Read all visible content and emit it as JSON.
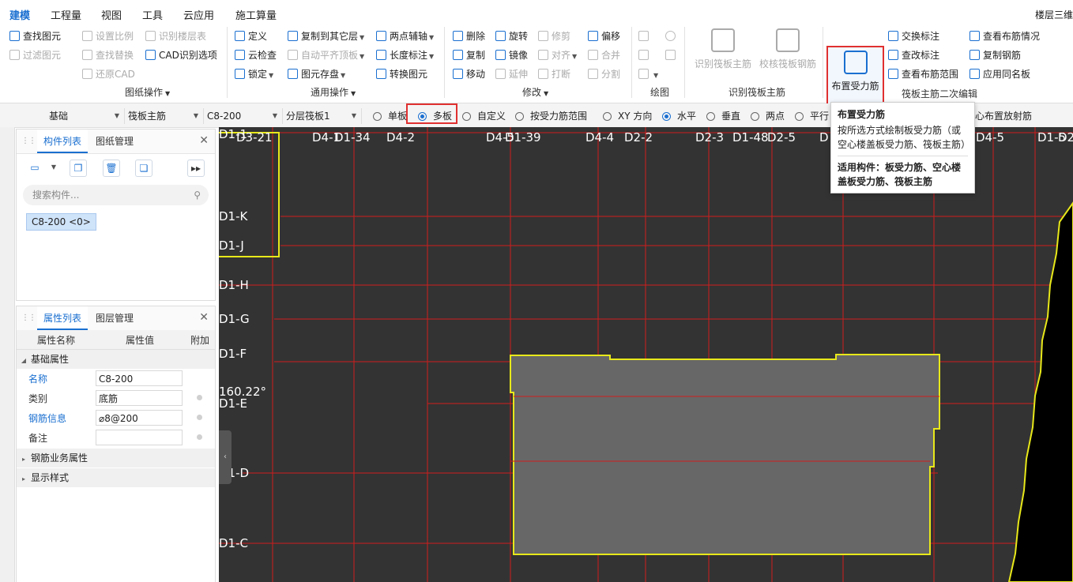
{
  "menu": {
    "tabs": [
      "建模",
      "工程量",
      "视图",
      "工具",
      "云应用",
      "施工算量"
    ],
    "active": "建模",
    "right_text": "楼层三维"
  },
  "ribbon": {
    "drawing_ops": {
      "items": [
        "查找图元",
        "设置比例",
        "识别楼层表",
        "过滤图元",
        "查找替换",
        "CAD识别选项",
        "还原CAD"
      ],
      "group_label": "图纸操作"
    },
    "common_ops": {
      "items": [
        "定义",
        "复制到其它层",
        "两点辅轴",
        "云检查",
        "自动平齐顶板",
        "长度标注",
        "锁定",
        "图元存盘",
        "转换图元"
      ],
      "group_label": "通用操作"
    },
    "modify": {
      "items": [
        "删除",
        "旋转",
        "修剪",
        "偏移",
        "复制",
        "镜像",
        "对齐",
        "合并",
        "移动",
        "延伸",
        "打断",
        "分割"
      ],
      "group_label": "修改"
    },
    "draw": {
      "group_label": "绘图"
    },
    "identify": {
      "items": [
        "识别筏板主筋",
        "校核筏板钢筋"
      ],
      "group_label": "识别筏板主筋"
    },
    "secondary": {
      "big_button": "布置受力筋",
      "items": [
        "交换标注",
        "查看布筋情况",
        "查改标注",
        "复制钢筋",
        "查看布筋范围",
        "应用同名板"
      ],
      "group_label": "筏板主筋二次编辑"
    }
  },
  "toolbar": {
    "selects": [
      "基础",
      "筏板主筋",
      "C8-200",
      "分层筏板1"
    ],
    "radios_a": [
      {
        "label": "单板",
        "checked": false
      },
      {
        "label": "多板",
        "checked": true
      },
      {
        "label": "自定义",
        "checked": false
      },
      {
        "label": "按受力筋范围",
        "checked": false
      }
    ],
    "radios_b": [
      {
        "label": "XY 方向",
        "checked": false
      },
      {
        "label": "水平",
        "checked": true
      },
      {
        "label": "垂直",
        "checked": false
      },
      {
        "label": "两点",
        "checked": false
      },
      {
        "label": "平行",
        "checked": false
      }
    ],
    "trailing_text": "心布置放射筋"
  },
  "component_panel": {
    "tabs": [
      "构件列表",
      "图纸管理"
    ],
    "search_placeholder": "搜索构件...",
    "items": [
      "C8-200 <0>"
    ]
  },
  "property_panel": {
    "tabs": [
      "属性列表",
      "图层管理"
    ],
    "headers": [
      "属性名称",
      "属性值",
      "附加"
    ],
    "group_basic": "基础属性",
    "rows": [
      {
        "name": "名称",
        "value": "C8-200",
        "blue": true
      },
      {
        "name": "类别",
        "value": "底筋",
        "blue": false
      },
      {
        "name": "钢筋信息",
        "value": "⌀8@200",
        "blue": true
      },
      {
        "name": "备注",
        "value": "",
        "blue": false
      }
    ],
    "group_rebar": "钢筋业务属性",
    "group_display": "显示样式"
  },
  "canvas": {
    "top_axis_labels": [
      "D1-1",
      "D3-21",
      "D4-1",
      "D1-34",
      "D4-2",
      "D4-5",
      "D1-39",
      "D4-4",
      "D2-2",
      "D2-3",
      "D1-48",
      "D2-5",
      "D",
      "D4-5",
      "D1-5",
      "D2"
    ],
    "left_axis_labels": [
      "D1-K",
      "D1-J",
      "D1-H",
      "D1-G",
      "D1-F",
      "D1-E",
      "D1-D",
      "D1-C"
    ],
    "angle_text": "160.22°",
    "colors": {
      "background": "#333333",
      "grid": "#d01c1c",
      "slab_fill": "#676767",
      "outline": "#e8e81a"
    }
  },
  "tooltip": {
    "title": "布置受力筋",
    "desc": "按所选方式绘制板受力筋（或空心楼盖板受力筋、筏板主筋）",
    "footer": "适用构件：板受力筋、空心楼盖板受力筋、筏板主筋"
  },
  "accent_color": "#1a6fd0",
  "highlight_color": "#e03030"
}
